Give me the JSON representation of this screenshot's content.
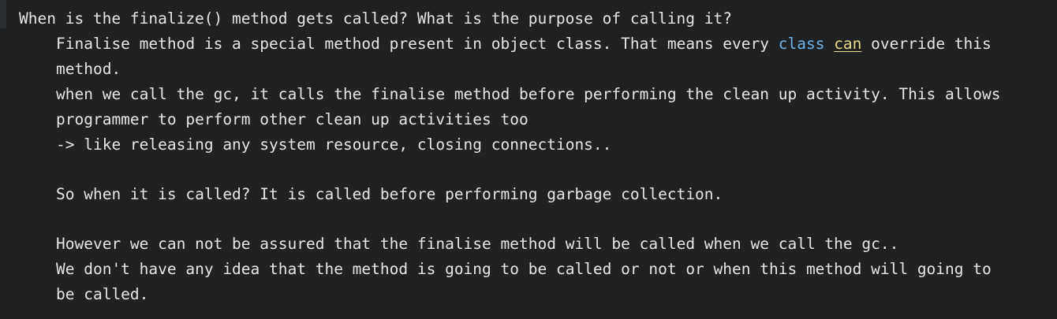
{
  "editor": {
    "question": "When is the finalize() method gets called? What is the purpose of calling it?",
    "line1_pre": "Finalise method is a special method present in object class. That means every ",
    "line1_kw": "class",
    "line1_sp": " ",
    "line1_hl": "can",
    "line1_post": " override this",
    "line2": "method.",
    "line3": "when we call the gc, it calls the finalise method before performing the clean up activity. This allows",
    "line4": "programmer to perform other clean up activities too",
    "line5": "-> like releasing any system resource, closing connections..",
    "line7": "So when it is called? It is called before performing garbage collection.",
    "line9": "However we can not be assured that the finalise method will be called when we call the gc..",
    "line10": "We don't have any idea that the method is going to be called or not or when this method will going to",
    "line11": "be called."
  },
  "colors": {
    "background": "#1f2122",
    "text": "#e6e6e6",
    "keyword": "#6fb3e8",
    "highlight": "#e8d98a"
  }
}
